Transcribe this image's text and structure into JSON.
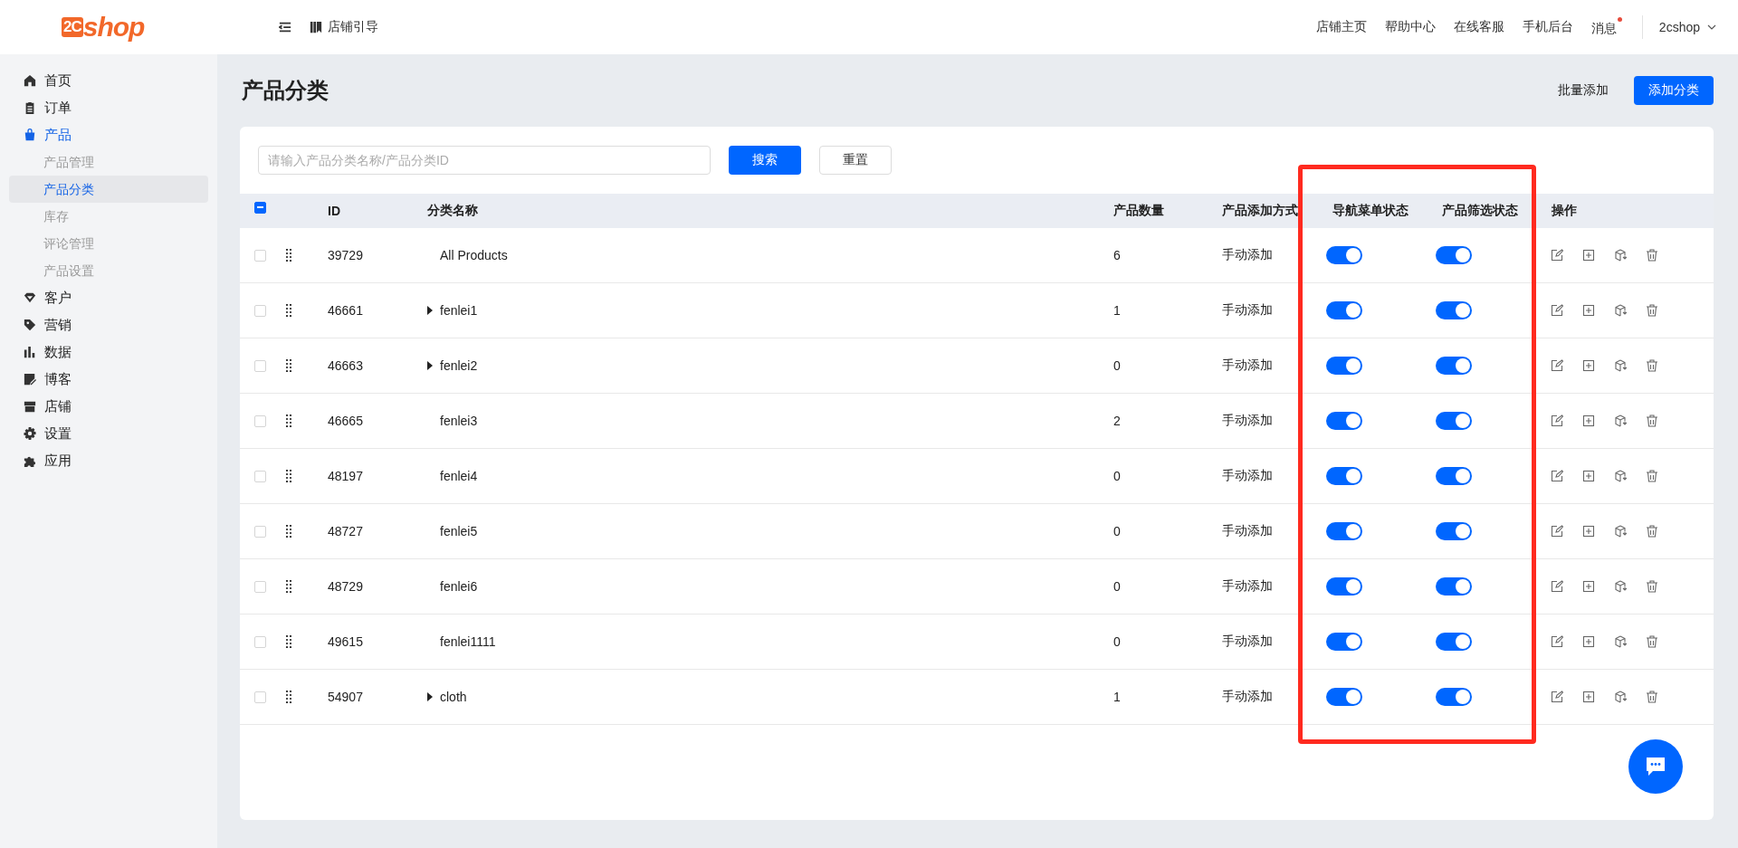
{
  "header": {
    "logo": {
      "mark": "2C",
      "word": "shop"
    },
    "guide_link": "店铺引导",
    "nav_links": [
      "店铺主页",
      "帮助中心",
      "在线客服",
      "手机后台"
    ],
    "messages": {
      "label": "消息",
      "unread": true
    },
    "account": "2cshop"
  },
  "sidebar": {
    "items": [
      {
        "label": "首页",
        "selected": false
      },
      {
        "label": "订单",
        "selected": false
      },
      {
        "label": "产品",
        "selected": true,
        "children": [
          {
            "label": "产品管理",
            "selected": false
          },
          {
            "label": "产品分类",
            "selected": true
          },
          {
            "label": "库存",
            "selected": false
          },
          {
            "label": "评论管理",
            "selected": false
          },
          {
            "label": "产品设置",
            "selected": false
          }
        ]
      },
      {
        "label": "客户",
        "selected": false
      },
      {
        "label": "营销",
        "selected": false
      },
      {
        "label": "数据",
        "selected": false
      },
      {
        "label": "博客",
        "selected": false
      },
      {
        "label": "店铺",
        "selected": false
      },
      {
        "label": "设置",
        "selected": false
      },
      {
        "label": "应用",
        "selected": false
      }
    ]
  },
  "page": {
    "title": "产品分类",
    "actions": [
      {
        "label": "批量添加",
        "kind": "text"
      },
      {
        "label": "添加分类",
        "kind": "primary"
      }
    ]
  },
  "search": {
    "placeholder": "请输入产品分类名称/产品分类ID",
    "buttons": [
      {
        "label": "搜索",
        "kind": "primary"
      },
      {
        "label": "重置",
        "kind": "default"
      }
    ]
  },
  "table": {
    "select_all": {
      "indeterminate": true
    },
    "columns": [
      "ID",
      "分类名称",
      "产品数量",
      "产品添加方式",
      "导航菜单状态",
      "产品筛选状态",
      "操作"
    ],
    "rows": [
      {
        "id": "39729",
        "name": "All Products",
        "has_children": false,
        "count": "6",
        "method": "手动添加",
        "checked": false,
        "nav_on": true,
        "filter_on": true
      },
      {
        "id": "46661",
        "name": "fenlei1",
        "has_children": true,
        "count": "1",
        "method": "手动添加",
        "checked": false,
        "nav_on": true,
        "filter_on": true
      },
      {
        "id": "46663",
        "name": "fenlei2",
        "has_children": true,
        "count": "0",
        "method": "手动添加",
        "checked": false,
        "nav_on": true,
        "filter_on": true
      },
      {
        "id": "46665",
        "name": "fenlei3",
        "has_children": false,
        "count": "2",
        "method": "手动添加",
        "checked": false,
        "nav_on": true,
        "filter_on": true
      },
      {
        "id": "48197",
        "name": "fenlei4",
        "has_children": false,
        "count": "0",
        "method": "手动添加",
        "checked": false,
        "nav_on": true,
        "filter_on": true
      },
      {
        "id": "48727",
        "name": "fenlei5",
        "has_children": false,
        "count": "0",
        "method": "手动添加",
        "checked": false,
        "nav_on": true,
        "filter_on": true
      },
      {
        "id": "48729",
        "name": "fenlei6",
        "has_children": false,
        "count": "0",
        "method": "手动添加",
        "checked": false,
        "nav_on": true,
        "filter_on": true
      },
      {
        "id": "49615",
        "name": "fenlei1111",
        "has_children": false,
        "count": "0",
        "method": "手动添加",
        "checked": false,
        "nav_on": true,
        "filter_on": true
      },
      {
        "id": "54907",
        "name": "cloth",
        "has_children": true,
        "count": "1",
        "method": "手动添加",
        "checked": false,
        "nav_on": true,
        "filter_on": true
      }
    ]
  },
  "highlight": {
    "shown": true,
    "color": "#ff2a1f"
  }
}
